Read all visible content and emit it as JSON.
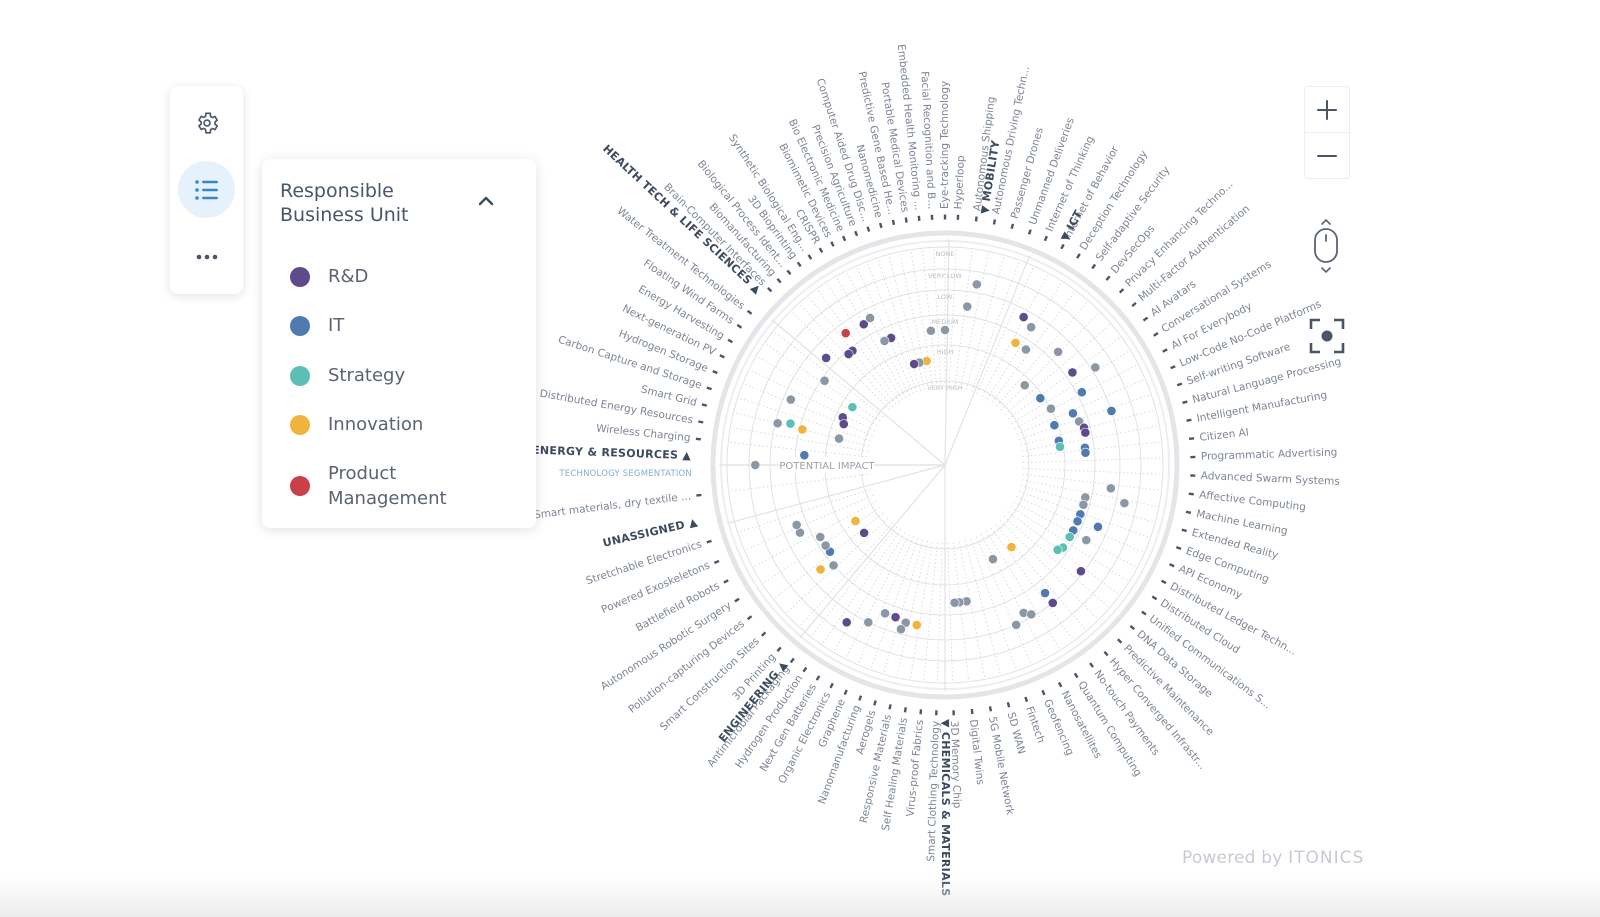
{
  "toolbar": {
    "items": [
      {
        "name": "settings",
        "icon": "gear-icon"
      },
      {
        "name": "legend",
        "icon": "list-icon",
        "active": true
      },
      {
        "name": "more",
        "icon": "more-horizontal-icon"
      }
    ]
  },
  "legend": {
    "title": "Responsible Business Unit",
    "expanded": true,
    "items": [
      {
        "label": "R&D",
        "color": "#5e4b8b"
      },
      {
        "label": "IT",
        "color": "#4f7bb0"
      },
      {
        "label": "Strategy",
        "color": "#5bbfb6"
      },
      {
        "label": "Innovation",
        "color": "#f0b43c"
      },
      {
        "label": "Product Management",
        "color": "#c94049"
      }
    ]
  },
  "controls": {
    "zoom_in": "+",
    "zoom_out": "−",
    "scroll_hint_icon": "mouse-scroll-icon",
    "recenter_icon": "focus-center-icon"
  },
  "footer": {
    "powered_by": "Powered by",
    "brand": "ITONICS"
  },
  "chart_data": {
    "type": "radar",
    "axis_label": "POTENTIAL IMPACT",
    "subsegment_label": "TECHNOLOGY SEGMENTATION",
    "rings": [
      "NONE",
      "VERY LOW",
      "LOW",
      "MEDIUM",
      "HIGH",
      "VERY HIGH"
    ],
    "unassigned_color": "#8c97a6",
    "segments": [
      {
        "name": "MOBILITY",
        "technologies": [
          "Hyperloop",
          "Autonomous Shipping",
          "Autonomous Driving Techn...",
          "Passenger Drones",
          "Unmanned Deliveries"
        ]
      },
      {
        "name": "ICT",
        "technologies": [
          "Internet of Thinking",
          "Internet of Behavior",
          "Deception Technology",
          "Self-adaptive Security",
          "DevSecOps",
          "Privacy Enhancing Techno...",
          "Multi-Factor Authentication",
          "AI Avatars",
          "Conversational Systems",
          "AI For Everybody",
          "Low-Code No-Code Platforms",
          "Self-writing Software",
          "Natural Language Processing",
          "Intelligent Manufacturing",
          "Citizen AI",
          "Programmatic Advertising",
          "Advanced Swarm Systems",
          "Affective Computing",
          "Machine Learning",
          "Extended Reality",
          "Edge Computing",
          "API Economy",
          "Distributed Ledger Techn...",
          "Distributed Cloud",
          "Unified Communications S...",
          "DNA Data Storage",
          "Predictive Maintenance",
          "Hyper Converged Infrastr...",
          "No-touch Payments",
          "Quantum Computing",
          "Nanosatellites",
          "Geofencing",
          "Fintech",
          "SD WAN",
          "5G Mobile Network",
          "Digital Twins",
          "3D Memory Chip"
        ]
      },
      {
        "name": "CHEMICALS & MATERIALS",
        "technologies": [
          "Smart Clothing Technology",
          "Virus-proof Fabrics",
          "Self Healing Materials",
          "Responsive Materials",
          "Aerogels",
          "Nanomanufacturing",
          "Graphene",
          "Organic Electronics",
          "Next Gen Batteries",
          "Hydrogen Production",
          "Antimicrobial Packaging"
        ]
      },
      {
        "name": "ENGINEERING",
        "technologies": [
          "3D Printing",
          "Smart Construction Sites",
          "Pollution-capturing Devices",
          "Autonomous Robotic Surgery",
          "Battlefield Robots",
          "Powered Exoskeletons",
          "Stretchable Electronics"
        ]
      },
      {
        "name": "UNASSIGNED",
        "technologies": [
          "Smart materials, dry textile ..."
        ]
      },
      {
        "name": "ENERGY & RESOURCES",
        "technologies": [
          "Wireless Charging",
          "Distributed Energy Resources",
          "Smart Grid",
          "Carbon Capture and Storage",
          "Hydrogen Storage",
          "Next-generation PV",
          "Energy Harvesting",
          "Floating Wind Farms",
          "Water Treatment Technologies"
        ]
      },
      {
        "name": "HEALTH TECH & LIFE SCIENCES",
        "technologies": [
          "Brain-Computer Interfaces",
          "Biomanufacturing",
          "Biological Process Ident...",
          "3D Bioprinting",
          "Synthetic Biological Eng...",
          "CRISPR",
          "Biomimetic Devices",
          "Bio Electronic Medicine",
          "Precision Agriculture",
          "Computer Aided Drug Disc...",
          "Nanomedicine",
          "Predictive Gene Based He...",
          "Portable Medical Devices",
          "Embedded Health Monitoring ...",
          "Facial Recognition and B...",
          "Eye-tracking Technology"
        ]
      }
    ],
    "points": [
      {
        "angle": 80,
        "ring": 2.6,
        "unit": "none"
      },
      {
        "angle": 82,
        "ring": 3.6,
        "unit": "none"
      },
      {
        "angle": 62,
        "ring": 3.3,
        "unit": "R&D"
      },
      {
        "angle": 58,
        "ring": 3.5,
        "unit": "none"
      },
      {
        "angle": 45,
        "ring": 3.6,
        "unit": "none"
      },
      {
        "angle": 60,
        "ring": 4.3,
        "unit": "Innovation"
      },
      {
        "angle": 55,
        "ring": 4.3,
        "unit": "none"
      },
      {
        "angle": 90,
        "ring": 4.5,
        "unit": "none"
      },
      {
        "angle": 96,
        "ring": 4.5,
        "unit": "none"
      },
      {
        "angle": 113,
        "ring": 4.4,
        "unit": "R&D"
      },
      {
        "angle": 116,
        "ring": 4.4,
        "unit": "none"
      },
      {
        "angle": 120,
        "ring": 3.5,
        "unit": "R&D"
      },
      {
        "angle": 117,
        "ring": 3.4,
        "unit": "none"
      },
      {
        "angle": 127,
        "ring": 3.4,
        "unit": "Product Management"
      },
      {
        "angle": 138,
        "ring": 3.6,
        "unit": "R&D"
      },
      {
        "angle": 129,
        "ring": 4.1,
        "unit": "R&D"
      },
      {
        "angle": 131,
        "ring": 4.1,
        "unit": "R&D"
      },
      {
        "angle": 157,
        "ring": 3.3,
        "unit": "none"
      },
      {
        "angle": 145,
        "ring": 4.1,
        "unit": "none"
      },
      {
        "angle": 166,
        "ring": 3.1,
        "unit": "none"
      },
      {
        "angle": 165,
        "ring": 3.6,
        "unit": "Strategy"
      },
      {
        "angle": 166,
        "ring": 4.1,
        "unit": "Innovation"
      },
      {
        "angle": 176,
        "ring": 4.3,
        "unit": "IT"
      },
      {
        "angle": 100,
        "ring": 5.4,
        "unit": "Innovation"
      },
      {
        "angle": 104,
        "ring": 5.4,
        "unit": "none"
      },
      {
        "angle": 107,
        "ring": 5.4,
        "unit": "R&D"
      },
      {
        "angle": 155,
        "ring": 5.2,
        "unit": "R&D"
      },
      {
        "angle": 148,
        "ring": 5.3,
        "unit": "Strategy"
      },
      {
        "angle": 158,
        "ring": 5.3,
        "unit": "R&D"
      },
      {
        "angle": 166,
        "ring": 5.3,
        "unit": "none"
      },
      {
        "angle": 180,
        "ring": 2.3,
        "unit": "none"
      },
      {
        "angle": 45,
        "ring": 5.2,
        "unit": "none"
      },
      {
        "angle": 35,
        "ring": 5.1,
        "unit": "IT"
      },
      {
        "angle": 28,
        "ring": 5.0,
        "unit": "none"
      },
      {
        "angle": 20,
        "ring": 5.1,
        "unit": "IT"
      },
      {
        "angle": 12,
        "ring": 5.1,
        "unit": "IT"
      },
      {
        "angle": 9,
        "ring": 5.1,
        "unit": "Strategy"
      },
      {
        "angle": 36,
        "ring": 3.7,
        "unit": "R&D"
      },
      {
        "angle": 28,
        "ring": 3.8,
        "unit": "IT"
      },
      {
        "angle": 22,
        "ring": 4.4,
        "unit": "IT"
      },
      {
        "angle": 18,
        "ring": 4.3,
        "unit": "none"
      },
      {
        "angle": 15,
        "ring": 4.2,
        "unit": "R&D"
      },
      {
        "angle": 13,
        "ring": 4.2,
        "unit": "R&D"
      },
      {
        "angle": 7,
        "ring": 4.3,
        "unit": "IT"
      },
      {
        "angle": 5,
        "ring": 4.3,
        "unit": "IT"
      },
      {
        "angle": 33,
        "ring": 2.8,
        "unit": "none"
      },
      {
        "angle": 18,
        "ring": 3.0,
        "unit": "IT"
      },
      {
        "angle": -8,
        "ring": 3.3,
        "unit": "none"
      },
      {
        "angle": -12,
        "ring": 2.6,
        "unit": "none"
      },
      {
        "angle": -13,
        "ring": 4.2,
        "unit": "none"
      },
      {
        "angle": -16,
        "ring": 4.2,
        "unit": "none"
      },
      {
        "angle": -20,
        "ring": 4.2,
        "unit": "IT"
      },
      {
        "angle": -23,
        "ring": 4.2,
        "unit": "IT"
      },
      {
        "angle": -27,
        "ring": 4.2,
        "unit": "IT"
      },
      {
        "angle": -30,
        "ring": 4.2,
        "unit": "Strategy"
      },
      {
        "angle": -35,
        "ring": 4.2,
        "unit": "Strategy"
      },
      {
        "angle": -37,
        "ring": 4.3,
        "unit": "Strategy"
      },
      {
        "angle": -22,
        "ring": 3.4,
        "unit": "IT"
      },
      {
        "angle": -28,
        "ring": 3.6,
        "unit": "none"
      },
      {
        "angle": -38,
        "ring": 3.1,
        "unit": "R&D"
      },
      {
        "angle": -52,
        "ring": 3.5,
        "unit": "IT"
      },
      {
        "angle": -62,
        "ring": 3.3,
        "unit": "none"
      },
      {
        "angle": -60,
        "ring": 3.1,
        "unit": "none"
      },
      {
        "angle": -66,
        "ring": 3.0,
        "unit": "none"
      },
      {
        "angle": -51,
        "ring": 5.4,
        "unit": "Innovation"
      },
      {
        "angle": -63,
        "ring": 5.4,
        "unit": "none"
      },
      {
        "angle": -81,
        "ring": 4.4,
        "unit": "none"
      },
      {
        "angle": -84,
        "ring": 4.4,
        "unit": "none"
      },
      {
        "angle": -86,
        "ring": 4.4,
        "unit": "none"
      },
      {
        "angle": -100,
        "ring": 3.5,
        "unit": "Innovation"
      },
      {
        "angle": -104,
        "ring": 3.5,
        "unit": "none"
      },
      {
        "angle": -108,
        "ring": 3.6,
        "unit": "R&D"
      },
      {
        "angle": -112,
        "ring": 3.6,
        "unit": "none"
      },
      {
        "angle": -105,
        "ring": 3.2,
        "unit": "none"
      },
      {
        "angle": -116,
        "ring": 3.0,
        "unit": "none"
      },
      {
        "angle": -138,
        "ring": 4.0,
        "unit": "none"
      },
      {
        "angle": -140,
        "ring": 3.5,
        "unit": "Innovation"
      },
      {
        "angle": -143,
        "ring": 4.2,
        "unit": "IT"
      },
      {
        "angle": -146,
        "ring": 4.2,
        "unit": "none"
      },
      {
        "angle": -150,
        "ring": 4.2,
        "unit": "none"
      },
      {
        "angle": -155,
        "ring": 3.6,
        "unit": "none"
      },
      {
        "angle": -158,
        "ring": 3.6,
        "unit": "none"
      },
      {
        "angle": -122,
        "ring": 2.5,
        "unit": "R&D"
      },
      {
        "angle": -148,
        "ring": 5.4,
        "unit": "Innovation"
      },
      {
        "angle": -140,
        "ring": 5.4,
        "unit": "R&D"
      },
      {
        "angle": -52,
        "ring": 3.0,
        "unit": "R&D"
      }
    ]
  }
}
